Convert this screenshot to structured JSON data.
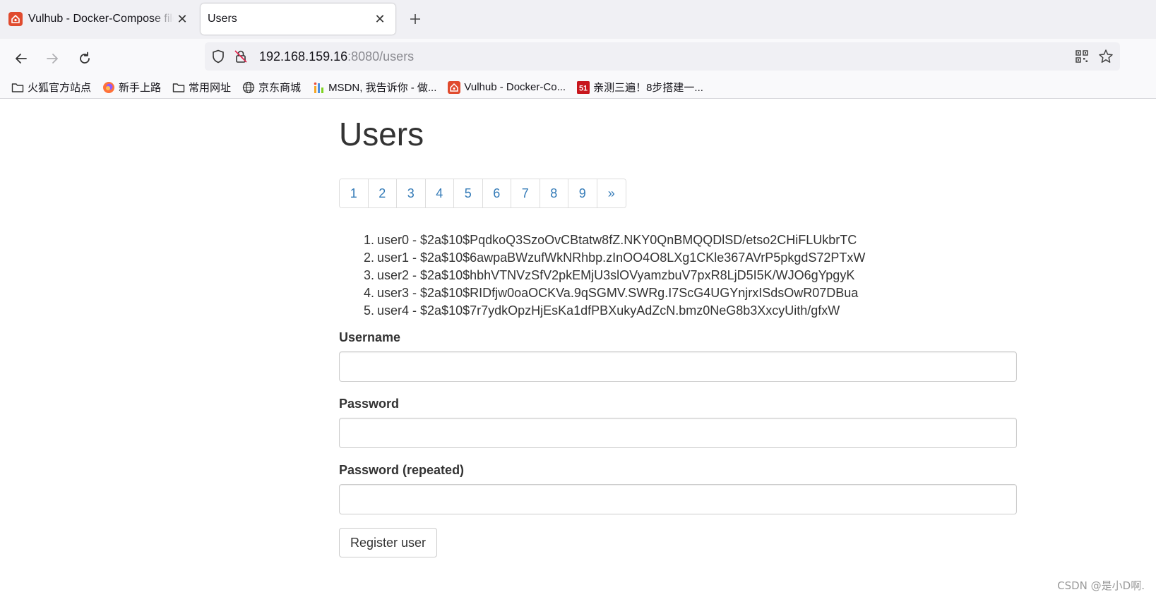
{
  "browser": {
    "tabs": [
      {
        "title": "Vulhub - Docker-Compose file for vulnerability environment",
        "favicon": "vulhub-icon",
        "active": false
      },
      {
        "title": "Users",
        "active": true
      }
    ],
    "url": {
      "host": "192.168.159.16",
      "rest": ":8080/users"
    },
    "bookmarks": [
      {
        "label": "火狐官方站点",
        "icon": "folder-icon"
      },
      {
        "label": "新手上路",
        "icon": "firefox-icon"
      },
      {
        "label": "常用网址",
        "icon": "folder-icon"
      },
      {
        "label": "京东商城",
        "icon": "globe-icon"
      },
      {
        "label": "MSDN, 我告诉你 - 做...",
        "icon": "msdn-icon"
      },
      {
        "label": "Vulhub - Docker-Co...",
        "icon": "vulhub-icon"
      },
      {
        "label": "亲测三遍！8步搭建一...",
        "icon": "51cto-icon"
      }
    ]
  },
  "page": {
    "title": "Users",
    "pagination": [
      "1",
      "2",
      "3",
      "4",
      "5",
      "6",
      "7",
      "8",
      "9",
      "»"
    ],
    "users": [
      {
        "num": "1.",
        "text": "user0 - $2a$10$PqdkoQ3SzoOvCBtatw8fZ.NKY0QnBMQQDlSD/etso2CHiFLUkbrTC"
      },
      {
        "num": "2.",
        "text": "user1 - $2a$10$6awpaBWzufWkNRhbp.zInOO4O8LXg1CKle367AVrP5pkgdS72PTxW"
      },
      {
        "num": "3.",
        "text": "user2 - $2a$10$hbhVTNVzSfV2pkEMjU3slOVyamzbuV7pxR8LjD5I5K/WJO6gYpgyK"
      },
      {
        "num": "4.",
        "text": "user3 - $2a$10$RIDfjw0oaOCKVa.9qSGMV.SWRg.I7ScG4UGYnjrxISdsOwR07DBua"
      },
      {
        "num": "5.",
        "text": "user4 - $2a$10$7r7ydkOpzHjEsKa1dfPBXukyAdZcN.bmz0NeG8b3XxcyUith/gfxW"
      }
    ],
    "form": {
      "username_label": "Username",
      "password_label": "Password",
      "password_repeat_label": "Password (repeated)",
      "submit_label": "Register user"
    }
  },
  "watermark": "CSDN @是小D啊."
}
